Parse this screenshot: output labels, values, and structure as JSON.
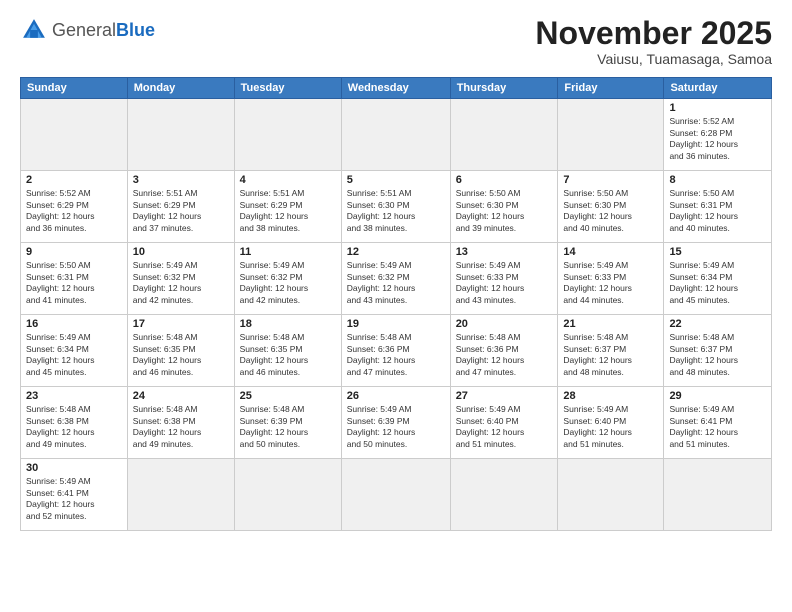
{
  "logo": {
    "general": "General",
    "blue": "Blue"
  },
  "header": {
    "month": "November 2025",
    "location": "Vaiusu, Tuamasaga, Samoa"
  },
  "weekdays": [
    "Sunday",
    "Monday",
    "Tuesday",
    "Wednesday",
    "Thursday",
    "Friday",
    "Saturday"
  ],
  "weeks": [
    [
      {
        "day": "",
        "info": ""
      },
      {
        "day": "",
        "info": ""
      },
      {
        "day": "",
        "info": ""
      },
      {
        "day": "",
        "info": ""
      },
      {
        "day": "",
        "info": ""
      },
      {
        "day": "",
        "info": ""
      },
      {
        "day": "1",
        "info": "Sunrise: 5:52 AM\nSunset: 6:28 PM\nDaylight: 12 hours\nand 36 minutes."
      }
    ],
    [
      {
        "day": "2",
        "info": "Sunrise: 5:52 AM\nSunset: 6:29 PM\nDaylight: 12 hours\nand 36 minutes."
      },
      {
        "day": "3",
        "info": "Sunrise: 5:51 AM\nSunset: 6:29 PM\nDaylight: 12 hours\nand 37 minutes."
      },
      {
        "day": "4",
        "info": "Sunrise: 5:51 AM\nSunset: 6:29 PM\nDaylight: 12 hours\nand 38 minutes."
      },
      {
        "day": "5",
        "info": "Sunrise: 5:51 AM\nSunset: 6:30 PM\nDaylight: 12 hours\nand 38 minutes."
      },
      {
        "day": "6",
        "info": "Sunrise: 5:50 AM\nSunset: 6:30 PM\nDaylight: 12 hours\nand 39 minutes."
      },
      {
        "day": "7",
        "info": "Sunrise: 5:50 AM\nSunset: 6:30 PM\nDaylight: 12 hours\nand 40 minutes."
      },
      {
        "day": "8",
        "info": "Sunrise: 5:50 AM\nSunset: 6:31 PM\nDaylight: 12 hours\nand 40 minutes."
      }
    ],
    [
      {
        "day": "9",
        "info": "Sunrise: 5:50 AM\nSunset: 6:31 PM\nDaylight: 12 hours\nand 41 minutes."
      },
      {
        "day": "10",
        "info": "Sunrise: 5:49 AM\nSunset: 6:32 PM\nDaylight: 12 hours\nand 42 minutes."
      },
      {
        "day": "11",
        "info": "Sunrise: 5:49 AM\nSunset: 6:32 PM\nDaylight: 12 hours\nand 42 minutes."
      },
      {
        "day": "12",
        "info": "Sunrise: 5:49 AM\nSunset: 6:32 PM\nDaylight: 12 hours\nand 43 minutes."
      },
      {
        "day": "13",
        "info": "Sunrise: 5:49 AM\nSunset: 6:33 PM\nDaylight: 12 hours\nand 43 minutes."
      },
      {
        "day": "14",
        "info": "Sunrise: 5:49 AM\nSunset: 6:33 PM\nDaylight: 12 hours\nand 44 minutes."
      },
      {
        "day": "15",
        "info": "Sunrise: 5:49 AM\nSunset: 6:34 PM\nDaylight: 12 hours\nand 45 minutes."
      }
    ],
    [
      {
        "day": "16",
        "info": "Sunrise: 5:49 AM\nSunset: 6:34 PM\nDaylight: 12 hours\nand 45 minutes."
      },
      {
        "day": "17",
        "info": "Sunrise: 5:48 AM\nSunset: 6:35 PM\nDaylight: 12 hours\nand 46 minutes."
      },
      {
        "day": "18",
        "info": "Sunrise: 5:48 AM\nSunset: 6:35 PM\nDaylight: 12 hours\nand 46 minutes."
      },
      {
        "day": "19",
        "info": "Sunrise: 5:48 AM\nSunset: 6:36 PM\nDaylight: 12 hours\nand 47 minutes."
      },
      {
        "day": "20",
        "info": "Sunrise: 5:48 AM\nSunset: 6:36 PM\nDaylight: 12 hours\nand 47 minutes."
      },
      {
        "day": "21",
        "info": "Sunrise: 5:48 AM\nSunset: 6:37 PM\nDaylight: 12 hours\nand 48 minutes."
      },
      {
        "day": "22",
        "info": "Sunrise: 5:48 AM\nSunset: 6:37 PM\nDaylight: 12 hours\nand 48 minutes."
      }
    ],
    [
      {
        "day": "23",
        "info": "Sunrise: 5:48 AM\nSunset: 6:38 PM\nDaylight: 12 hours\nand 49 minutes."
      },
      {
        "day": "24",
        "info": "Sunrise: 5:48 AM\nSunset: 6:38 PM\nDaylight: 12 hours\nand 49 minutes."
      },
      {
        "day": "25",
        "info": "Sunrise: 5:48 AM\nSunset: 6:39 PM\nDaylight: 12 hours\nand 50 minutes."
      },
      {
        "day": "26",
        "info": "Sunrise: 5:49 AM\nSunset: 6:39 PM\nDaylight: 12 hours\nand 50 minutes."
      },
      {
        "day": "27",
        "info": "Sunrise: 5:49 AM\nSunset: 6:40 PM\nDaylight: 12 hours\nand 51 minutes."
      },
      {
        "day": "28",
        "info": "Sunrise: 5:49 AM\nSunset: 6:40 PM\nDaylight: 12 hours\nand 51 minutes."
      },
      {
        "day": "29",
        "info": "Sunrise: 5:49 AM\nSunset: 6:41 PM\nDaylight: 12 hours\nand 51 minutes."
      }
    ],
    [
      {
        "day": "30",
        "info": "Sunrise: 5:49 AM\nSunset: 6:41 PM\nDaylight: 12 hours\nand 52 minutes."
      },
      {
        "day": "",
        "info": ""
      },
      {
        "day": "",
        "info": ""
      },
      {
        "day": "",
        "info": ""
      },
      {
        "day": "",
        "info": ""
      },
      {
        "day": "",
        "info": ""
      },
      {
        "day": "",
        "info": ""
      }
    ]
  ]
}
